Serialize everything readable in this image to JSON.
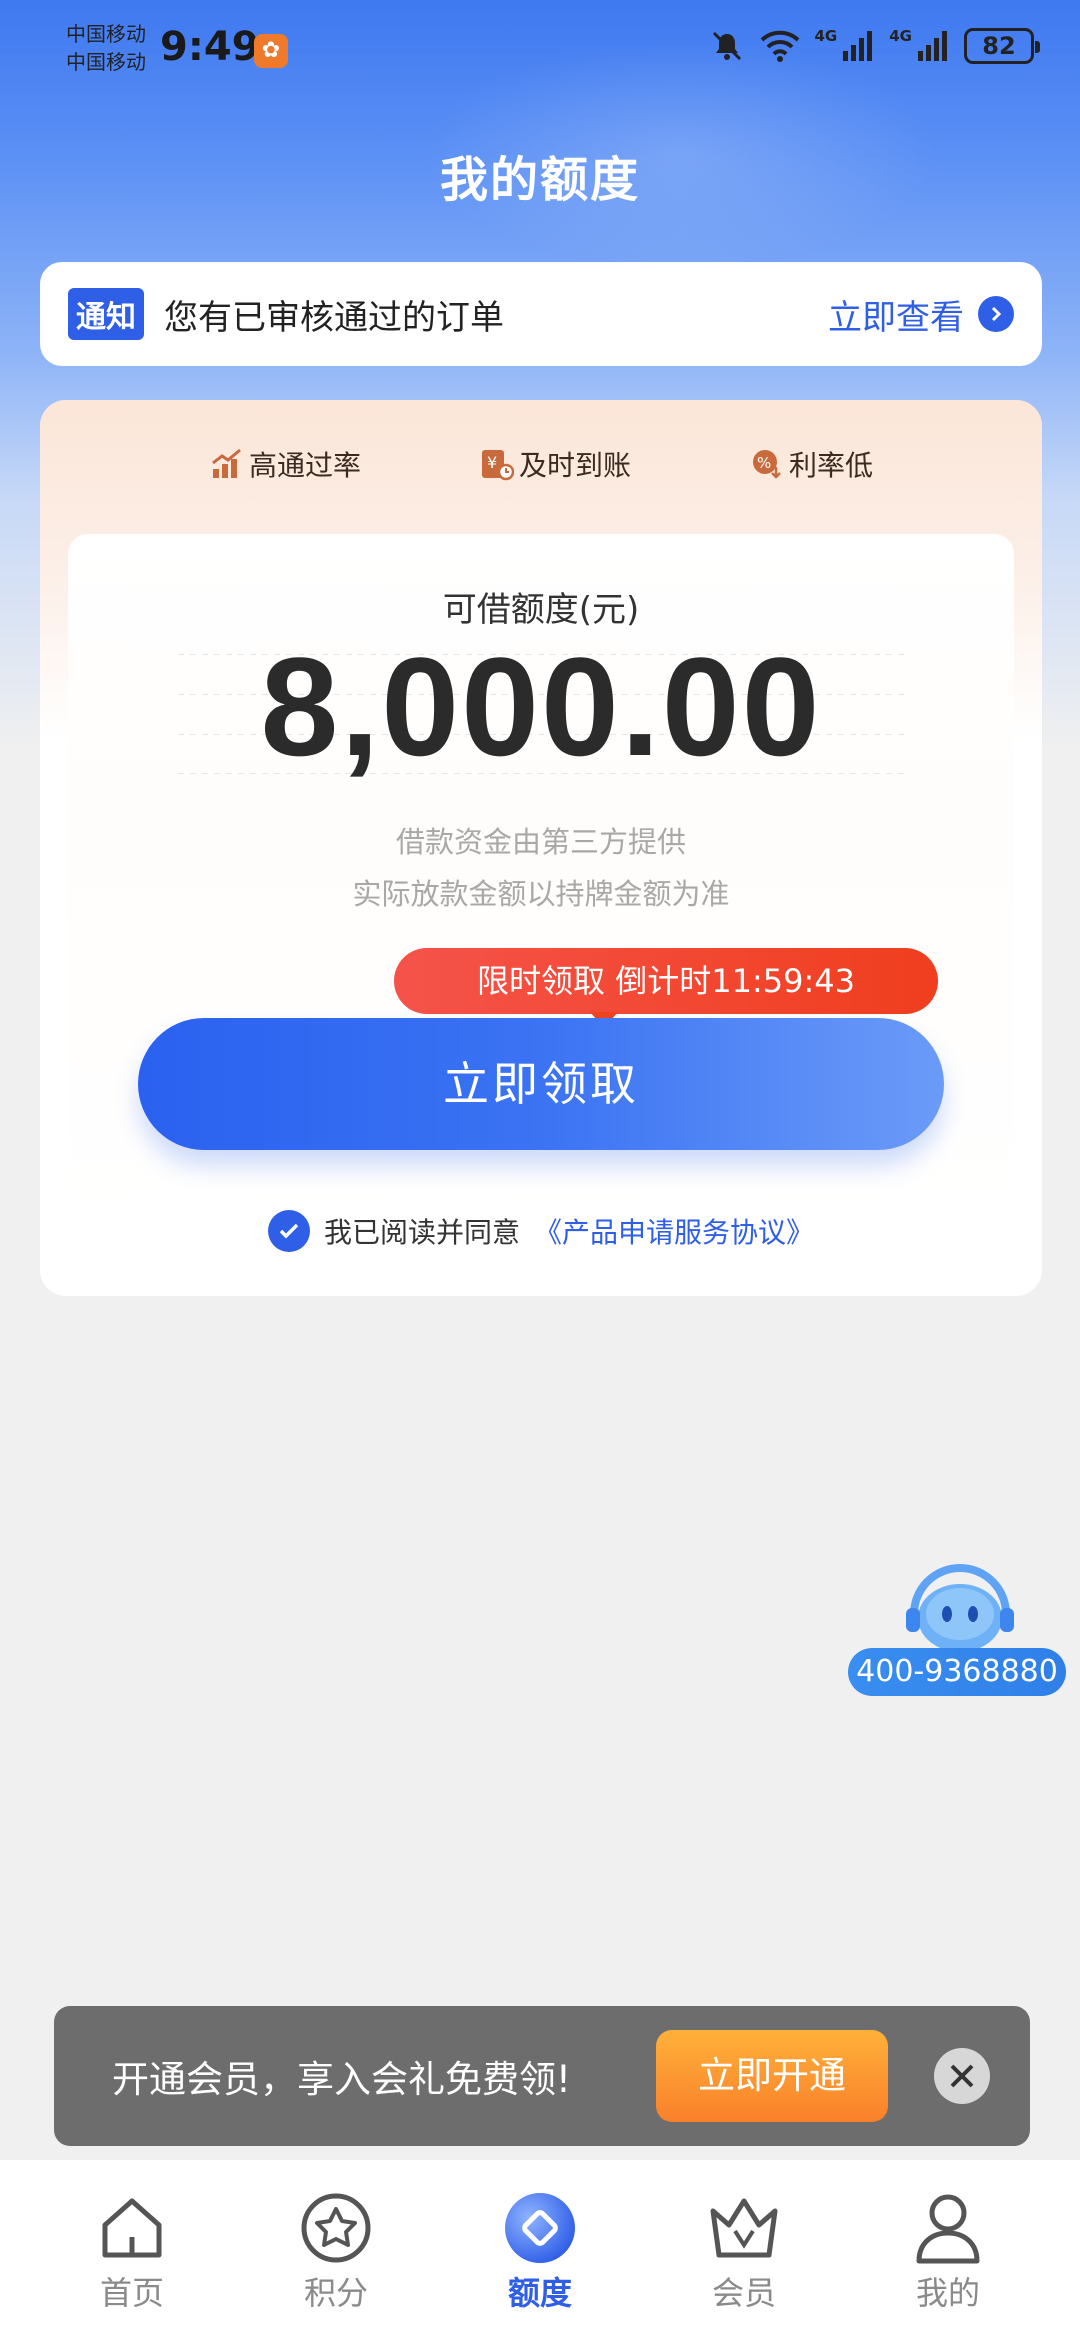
{
  "status_bar": {
    "carrier_1": "中国移动",
    "carrier_2": "中国移动",
    "time": "9:49",
    "network_1": "4G",
    "network_2": "4G",
    "battery": "82"
  },
  "header": {
    "title": "我的额度"
  },
  "notice": {
    "tag": "通知",
    "text": "您有已审核通过的订单",
    "link": "立即查看"
  },
  "features": [
    {
      "label": "高通过率",
      "icon": "chart-up-icon"
    },
    {
      "label": "及时到账",
      "icon": "yuan-clock-icon"
    },
    {
      "label": "利率低",
      "icon": "percent-down-icon"
    }
  ],
  "credit": {
    "label": "可借额度(元)",
    "amount": "8,000.00",
    "disclaimer_1": "借款资金由第三方提供",
    "disclaimer_2": "实际放款金额以持牌金额为准",
    "countdown": "限时领取 倒计时11:59:43",
    "claim_button": "立即领取",
    "agree_text": "我已阅读并同意",
    "agree_link": "《产品申请服务协议》"
  },
  "service": {
    "phone": "400-9368880"
  },
  "member_banner": {
    "text": "开通会员，享入会礼免费领!",
    "button": "立即开通"
  },
  "bottom_nav": [
    {
      "label": "首页",
      "icon": "home-icon"
    },
    {
      "label": "积分",
      "icon": "points-star-icon"
    },
    {
      "label": "额度",
      "icon": "quota-icon",
      "active": true
    },
    {
      "label": "会员",
      "icon": "crown-icon"
    },
    {
      "label": "我的",
      "icon": "profile-icon"
    }
  ],
  "colors": {
    "brand_blue": "#2f5ee7",
    "countdown_red": "#f0431f",
    "member_orange": "#f9802a"
  }
}
